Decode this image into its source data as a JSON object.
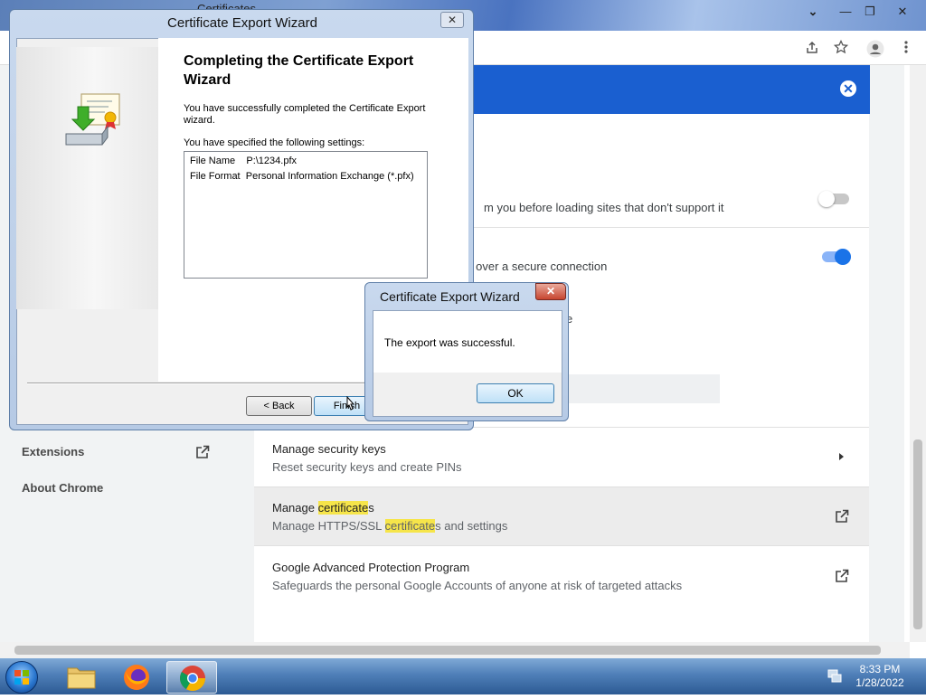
{
  "chrome": {
    "tab_title": "Certificates",
    "window_controls": {
      "chevron": "⌄",
      "minimize": "—",
      "restore": "❐",
      "close": "✕"
    },
    "toolbar_icons": [
      "share-icon",
      "star-icon",
      "profile-icon",
      "menu-icon"
    ],
    "banner_close": "✕",
    "nav": {
      "extensions": "Extensions",
      "about": "About Chrome"
    },
    "rows": {
      "partial_1": "m you before loading sites that don't support it",
      "partial_2": "s over a secure connection",
      "partial_3": "e",
      "security_keys_title": "Manage security keys",
      "security_keys_sub": "Reset security keys and create PINs",
      "certs_title_a": "Manage ",
      "certs_title_hl": "certificate",
      "certs_title_b": "s",
      "certs_sub_a": "Manage HTTPS/SSL ",
      "certs_sub_hl": "certificate",
      "certs_sub_b": "s and settings",
      "gapp_title": "Google Advanced Protection Program",
      "gapp_sub": "Safeguards the personal Google Accounts of anyone at risk of targeted attacks"
    },
    "toggles": {
      "https_first": false,
      "secure_dns": true
    },
    "colors": {
      "accent": "#1a5fd0",
      "highlight": "#f6e54a"
    }
  },
  "wizard": {
    "title": "Certificate Export Wizard",
    "close": "✕",
    "heading": "Completing the Certificate Export Wizard",
    "success_text": "You have successfully completed the Certificate Export wizard.",
    "settings_label": "You have specified the following settings:",
    "settings": [
      {
        "key": "File Name",
        "value": "P:\\1234.pfx"
      },
      {
        "key": "File Format",
        "value": "Personal Information Exchange (*.pfx)"
      }
    ],
    "back_button": "< Back",
    "finish_button": "Finish"
  },
  "message_box": {
    "title": "Certificate Export Wizard",
    "close": "✕",
    "text": "The export was successful.",
    "ok_button": "OK"
  },
  "taskbar": {
    "apps": [
      "explorer-icon",
      "firefox-icon",
      "chrome-icon"
    ],
    "time": "8:33 PM",
    "date": "1/28/2022"
  }
}
